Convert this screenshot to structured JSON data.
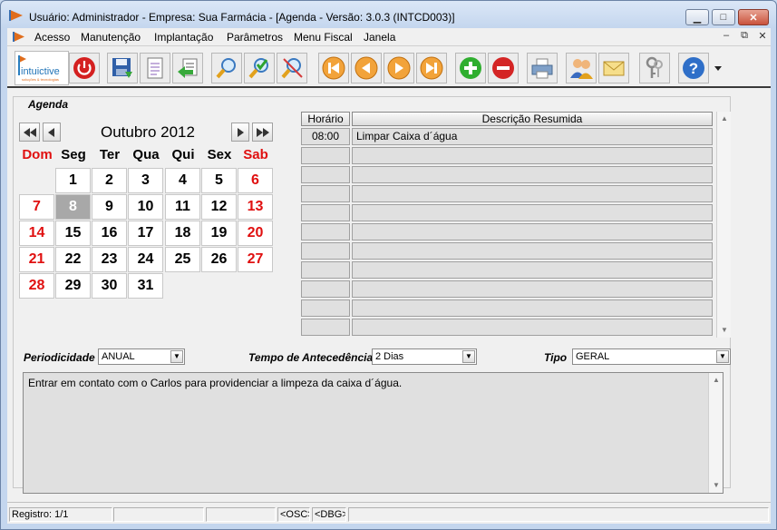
{
  "window": {
    "title": "Usuário: Administrador - Empresa: Sua Farmácia - [Agenda - Versão: 3.0.3 (INTCD003)]",
    "minimize_glyph": "▁",
    "maximize_glyph": "□",
    "close_glyph": "✕"
  },
  "menu": {
    "items": [
      "Acesso",
      "Manutenção",
      "Implantação",
      "Parâmetros",
      "Menu Fiscal",
      "Janela"
    ],
    "mdi": [
      "‒",
      "⧉",
      "✕"
    ]
  },
  "toolbar": {
    "logo_text": "intuictive",
    "logo_tagline": "soluções & tecnologias",
    "buttons": [
      {
        "name": "power-button",
        "icon": "power-icon"
      },
      {
        "name": "save-button",
        "icon": "save-icon"
      },
      {
        "name": "document-button",
        "icon": "document-icon"
      },
      {
        "name": "back-button",
        "icon": "back-arrow-icon"
      },
      {
        "name": "search-button",
        "icon": "magnifier-icon"
      },
      {
        "name": "search-check-button",
        "icon": "magnifier-check-icon"
      },
      {
        "name": "search-clear-button",
        "icon": "magnifier-clear-icon"
      },
      {
        "name": "first-record-button",
        "icon": "first-icon"
      },
      {
        "name": "previous-record-button",
        "icon": "previous-icon"
      },
      {
        "name": "next-record-button",
        "icon": "next-icon"
      },
      {
        "name": "last-record-button",
        "icon": "last-icon"
      },
      {
        "name": "add-button",
        "icon": "plus-icon"
      },
      {
        "name": "delete-button",
        "icon": "minus-icon"
      },
      {
        "name": "print-button",
        "icon": "printer-icon"
      },
      {
        "name": "users-button",
        "icon": "users-icon"
      },
      {
        "name": "mail-button",
        "icon": "envelope-icon"
      },
      {
        "name": "keys-button",
        "icon": "keys-icon"
      },
      {
        "name": "help-button",
        "icon": "help-icon"
      }
    ]
  },
  "agenda": {
    "group_label": "Agenda",
    "calendar": {
      "month_label": "Outubro 2012",
      "weekdays": [
        "Dom",
        "Seg",
        "Ter",
        "Qua",
        "Qui",
        "Sex",
        "Sab"
      ],
      "weeks": [
        [
          "",
          "1",
          "2",
          "3",
          "4",
          "5",
          "6"
        ],
        [
          "7",
          "8",
          "9",
          "10",
          "11",
          "12",
          "13"
        ],
        [
          "14",
          "15",
          "16",
          "17",
          "18",
          "19",
          "20"
        ],
        [
          "21",
          "22",
          "23",
          "24",
          "25",
          "26",
          "27"
        ],
        [
          "28",
          "29",
          "30",
          "31",
          "",
          "",
          ""
        ]
      ],
      "selected_day": "8",
      "nav": {
        "first": "◀◀",
        "prev": "◀",
        "next": "▶",
        "last": "▶▶"
      }
    },
    "schedule": {
      "headers": {
        "time": "Horário",
        "description": "Descrição Resumida"
      },
      "rows": [
        {
          "time": "08:00",
          "description": "Limpar Caixa d´água"
        },
        {
          "time": "",
          "description": ""
        },
        {
          "time": "",
          "description": ""
        },
        {
          "time": "",
          "description": ""
        },
        {
          "time": "",
          "description": ""
        },
        {
          "time": "",
          "description": ""
        },
        {
          "time": "",
          "description": ""
        },
        {
          "time": "",
          "description": ""
        },
        {
          "time": "",
          "description": ""
        },
        {
          "time": "",
          "description": ""
        },
        {
          "time": "",
          "description": ""
        }
      ]
    },
    "fields": {
      "periodicidade": {
        "label": "Periodicidade",
        "value": "ANUAL"
      },
      "antecedencia": {
        "label": "Tempo de Antecedência",
        "value": "2 Dias"
      },
      "tipo": {
        "label": "Tipo",
        "value": "GERAL"
      }
    },
    "notes": "Entrar em contato com o Carlos para providenciar a limpeza da caixa d´água."
  },
  "status": {
    "registro": "Registro: 1/1",
    "panel2": "",
    "panel3": "",
    "osc": "<OSC>",
    "dbg": "<DBG>",
    "panel6": ""
  },
  "colors": {
    "weekend": "#e01010",
    "selected_day_bg": "#a8a8a8",
    "accent": "#0b5fd1"
  }
}
